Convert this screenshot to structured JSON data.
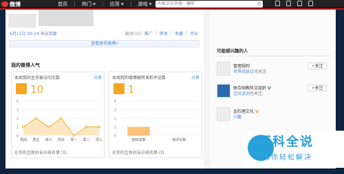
{
  "topbar": {
    "logo": "微博",
    "nav": [
      "首页",
      "热门 ▾",
      "应用 ▾",
      "游戏 ▾"
    ],
    "search_placeholder": "大家正在热搜：康熙"
  },
  "post": {
    "date": "6月11日 09:24",
    "source_prefix": "来自",
    "source": "百度",
    "actions": [
      "阅读(15)",
      "推广",
      "转发",
      "收藏",
      "评论"
    ]
  },
  "more_link": "查看更多微博»",
  "section_title": "我的微博人气",
  "card1": {
    "title": "本周我的主页被访问次数",
    "share": "分享",
    "number": "10",
    "foot_prefix": "在你的互粉好友中排名第",
    "foot_rank": "7",
    "foot_suffix": "位"
  },
  "card2": {
    "title": "本周我的微博被转发和评论数",
    "share": "分享",
    "number": "1",
    "foot_prefix": "在你的互粉好友中排名第",
    "foot_rank": "4",
    "foot_suffix": "位"
  },
  "chart_data": [
    {
      "type": "area",
      "categories": [
        "周四",
        "周五",
        "周六",
        "周日",
        "周一",
        "周二",
        "周三"
      ],
      "values": [
        1,
        2,
        1,
        2,
        0,
        1,
        1
      ],
      "ylim": [
        0,
        4
      ],
      "yticks": [
        "0",
        "1",
        "2",
        "3",
        "4"
      ]
    },
    {
      "type": "bar",
      "categories": [
        "被转发数",
        "被评论数"
      ],
      "values": [
        1,
        0
      ],
      "ylim": [
        0,
        4
      ],
      "yticks": [
        "0",
        "1",
        "2",
        "3",
        "4"
      ]
    }
  ],
  "side": {
    "title": "可能感兴趣的人",
    "items": [
      {
        "name": "管理规则",
        "desc_link": "世界阅读日",
        "desc_suffix": "也关注",
        "follow": "关注"
      },
      {
        "name": "联合国教科文组织",
        "badge": "V",
        "desc_link": "互动活动",
        "desc_suffix": "也关注",
        "follow": "关注"
      },
      {
        "name": "金石理文化",
        "badge": "V",
        "desc_link": "兴趣",
        "desc_suffix": "",
        "follow": "关注"
      }
    ]
  },
  "watermark": {
    "line1": "百科全说",
    "line2": "助你轻松解决"
  }
}
